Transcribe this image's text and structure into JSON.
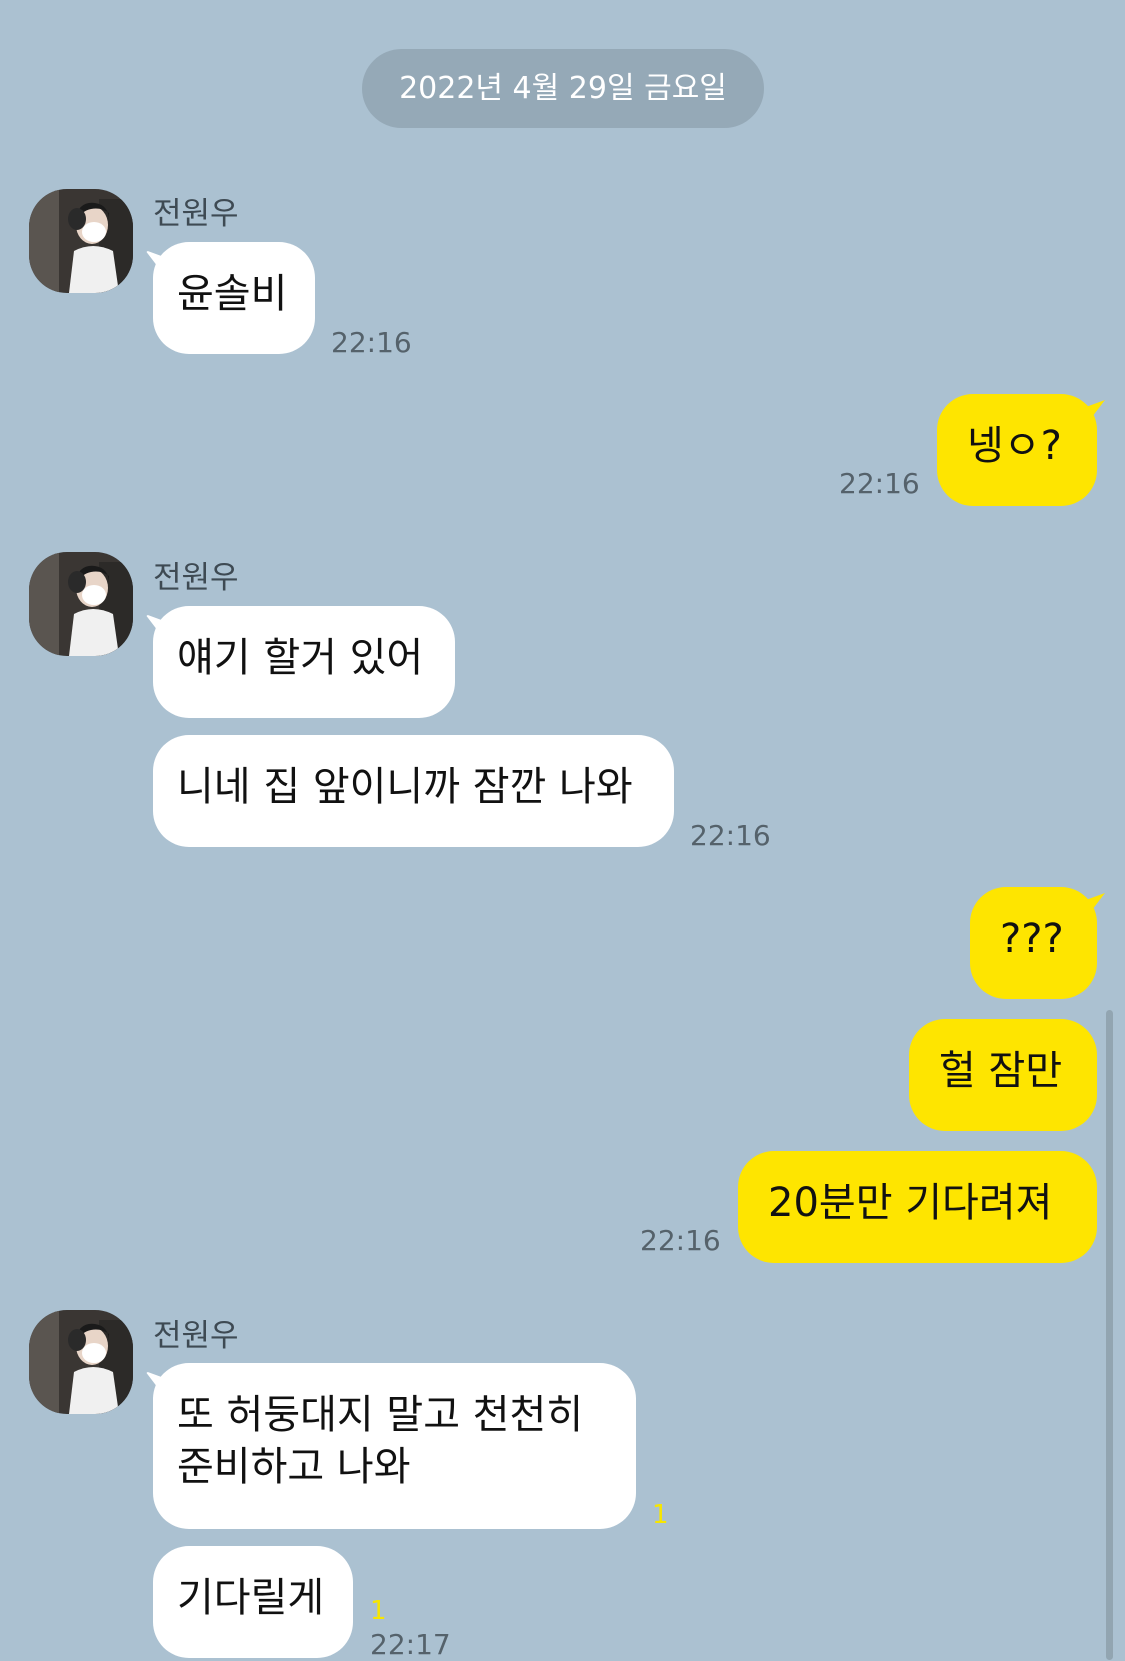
{
  "date_divider": "2022년 4월 29일 금요일",
  "contact": {
    "name": "전원우"
  },
  "messages": [
    {
      "side": "in",
      "text": "윤솔비",
      "time": "22:16"
    },
    {
      "side": "out",
      "text": "넹ㅇ?",
      "time": "22:16"
    },
    {
      "side": "in",
      "text": "얘기 할거 있어"
    },
    {
      "side": "in",
      "text": "니네 집 앞이니까 잠깐 나와",
      "time": "22:16"
    },
    {
      "side": "out",
      "text": "???"
    },
    {
      "side": "out",
      "text": "헐 잠만"
    },
    {
      "side": "out",
      "text": "20분만 기다려져",
      "time": "22:16"
    },
    {
      "side": "in",
      "line1": "또 허둥대지 말고 천천히",
      "line2": "준비하고 나와",
      "unread": "1"
    },
    {
      "side": "in",
      "text": "기다릴게",
      "unread": "1",
      "time": "22:17"
    }
  ],
  "colors": {
    "background": "#abc1d1",
    "incoming_bubble": "#ffffff",
    "outgoing_bubble": "#fee500",
    "unread_count": "#f7e600"
  }
}
